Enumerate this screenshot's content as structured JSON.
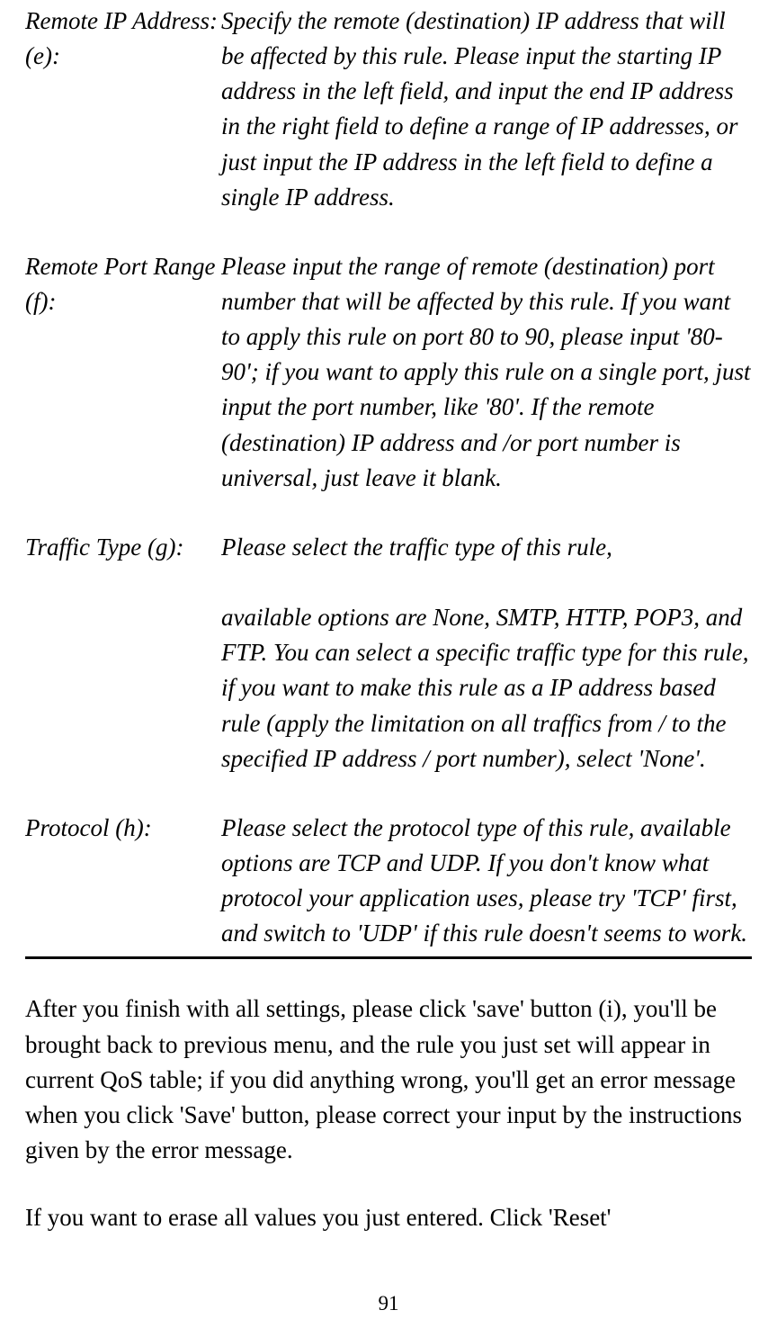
{
  "definitions": [
    {
      "term": "Remote IP Address: (e):",
      "desc": "Specify the remote (destination) IP address that will be affected by this rule. Please input the starting IP address in the left field, and input the end IP address in the right field to define a range of IP addresses, or just input the IP address in the left field to define a single IP address."
    },
    {
      "term": "Remote Port Range (f):",
      "desc": "Please input the range of remote (destination) port number that will be affected by this rule. If you want to apply this rule on port 80 to 90, please input '80-90'; if you want to apply this rule on a single port, just input the port number, like '80'. If the remote (destination) IP address and /or port number is universal, just leave it blank."
    },
    {
      "term": "Traffic Type (g):",
      "desc": "Please select the traffic type of this rule,\n\navailable options are None, SMTP, HTTP, POP3, and FTP. You can select a specific traffic type for this rule, if you want to make this rule as a IP address based rule (apply the limitation on all traffics from / to the specified IP address / port number), select 'None'."
    },
    {
      "term": "Protocol (h):",
      "desc": "Please select the protocol type of this rule, available options are TCP and UDP. If you don't know what protocol your application uses, please try 'TCP' first, and switch to 'UDP' if this rule doesn't seems to work."
    }
  ],
  "bodyParagraphs": [
    "After you finish with all settings, please click 'save' button (i), you'll be brought back to previous menu, and the rule you just set will appear in current QoS table; if you did anything wrong, you'll get an error message when you click 'Save' button, please correct your input by the instructions given by the error message.",
    "If you want to erase all values you just entered. Click 'Reset'"
  ],
  "pageNumber": "91"
}
